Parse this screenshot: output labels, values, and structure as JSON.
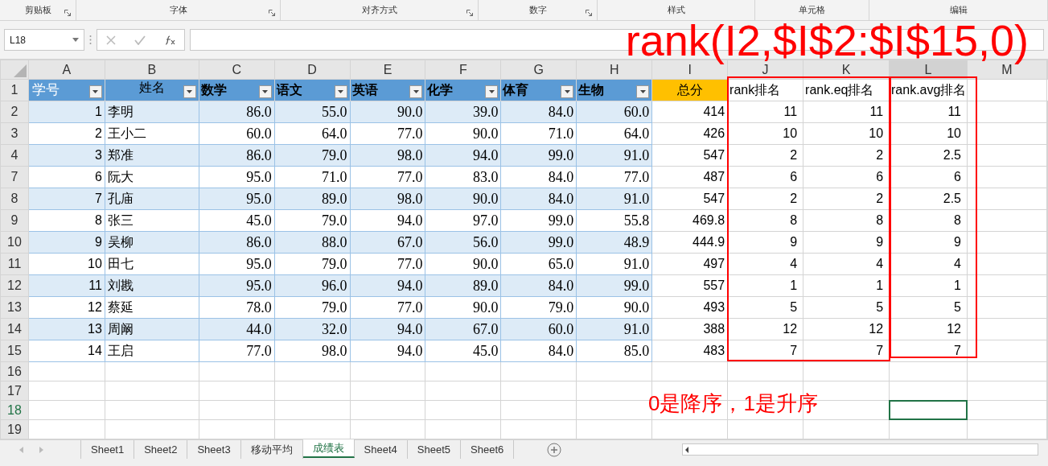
{
  "ribbon_groups": [
    {
      "label": "剪贴板",
      "launcher": true
    },
    {
      "label": "字体",
      "launcher": true
    },
    {
      "label": "对齐方式",
      "launcher": true
    },
    {
      "label": "数字",
      "launcher": true
    },
    {
      "label": "样式",
      "launcher": false
    },
    {
      "label": "单元格",
      "launcher": false
    },
    {
      "label": "编辑",
      "launcher": false
    }
  ],
  "name_box": "L18",
  "columns": [
    {
      "label": "A",
      "selected": false
    },
    {
      "label": "B",
      "selected": false
    },
    {
      "label": "C",
      "selected": false
    },
    {
      "label": "D",
      "selected": false
    },
    {
      "label": "E",
      "selected": false
    },
    {
      "label": "F",
      "selected": false
    },
    {
      "label": "G",
      "selected": false
    },
    {
      "label": "H",
      "selected": false
    },
    {
      "label": "I",
      "selected": false
    },
    {
      "label": "J",
      "selected": false
    },
    {
      "label": "K",
      "selected": false
    },
    {
      "label": "L",
      "selected": true
    },
    {
      "label": "M",
      "selected": false
    }
  ],
  "header_row": {
    "row": "1",
    "cells": [
      {
        "text": "学号",
        "kind": "filter_id"
      },
      {
        "text": "姓名",
        "kind": "filter_name"
      },
      {
        "text": "数学",
        "kind": "filter"
      },
      {
        "text": "语文",
        "kind": "filter"
      },
      {
        "text": "英语",
        "kind": "filter"
      },
      {
        "text": "化学",
        "kind": "filter"
      },
      {
        "text": "体育",
        "kind": "filter"
      },
      {
        "text": "生物",
        "kind": "filter"
      },
      {
        "text": "总分",
        "kind": "total"
      },
      {
        "text": "rank排名",
        "kind": "plain"
      },
      {
        "text": "rank.eq排名",
        "kind": "plain"
      },
      {
        "text": "rank.avg排名",
        "kind": "plain"
      }
    ]
  },
  "data_rows": [
    {
      "row": "2",
      "banded": true,
      "cells": [
        "1",
        "李明",
        "86.0",
        "55.0",
        "90.0",
        "39.0",
        "84.0",
        "60.0",
        "414",
        "11",
        "11",
        "11"
      ]
    },
    {
      "row": "3",
      "banded": false,
      "cells": [
        "2",
        "王小二",
        "60.0",
        "64.0",
        "77.0",
        "90.0",
        "71.0",
        "64.0",
        "426",
        "10",
        "10",
        "10"
      ]
    },
    {
      "row": "4",
      "banded": true,
      "cells": [
        "3",
        "郑准",
        "86.0",
        "79.0",
        "98.0",
        "94.0",
        "99.0",
        "91.0",
        "547",
        "2",
        "2",
        "2.5"
      ]
    },
    {
      "row": "7",
      "banded": false,
      "cells": [
        "6",
        "阮大",
        "95.0",
        "71.0",
        "77.0",
        "83.0",
        "84.0",
        "77.0",
        "487",
        "6",
        "6",
        "6"
      ]
    },
    {
      "row": "8",
      "banded": true,
      "cells": [
        "7",
        "孔庙",
        "95.0",
        "89.0",
        "98.0",
        "90.0",
        "84.0",
        "91.0",
        "547",
        "2",
        "2",
        "2.5"
      ]
    },
    {
      "row": "9",
      "banded": false,
      "cells": [
        "8",
        "张三",
        "45.0",
        "79.0",
        "94.0",
        "97.0",
        "99.0",
        "55.8",
        "469.8",
        "8",
        "8",
        "8"
      ]
    },
    {
      "row": "10",
      "banded": true,
      "cells": [
        "9",
        "吴柳",
        "86.0",
        "88.0",
        "67.0",
        "56.0",
        "99.0",
        "48.9",
        "444.9",
        "9",
        "9",
        "9"
      ]
    },
    {
      "row": "11",
      "banded": false,
      "cells": [
        "10",
        "田七",
        "95.0",
        "79.0",
        "77.0",
        "90.0",
        "65.0",
        "91.0",
        "497",
        "4",
        "4",
        "4"
      ]
    },
    {
      "row": "12",
      "banded": true,
      "cells": [
        "11",
        "刘戡",
        "95.0",
        "96.0",
        "94.0",
        "89.0",
        "84.0",
        "99.0",
        "557",
        "1",
        "1",
        "1"
      ]
    },
    {
      "row": "13",
      "banded": false,
      "cells": [
        "12",
        "蔡延",
        "78.0",
        "79.0",
        "77.0",
        "90.0",
        "79.0",
        "90.0",
        "493",
        "5",
        "5",
        "5"
      ]
    },
    {
      "row": "14",
      "banded": true,
      "cells": [
        "13",
        "周阚",
        "44.0",
        "32.0",
        "94.0",
        "67.0",
        "60.0",
        "91.0",
        "388",
        "12",
        "12",
        "12"
      ]
    },
    {
      "row": "15",
      "banded": false,
      "cells": [
        "14",
        "王启",
        "77.0",
        "98.0",
        "94.0",
        "45.0",
        "84.0",
        "85.0",
        "483",
        "7",
        "7",
        "7"
      ]
    }
  ],
  "empty_rows": [
    {
      "row": "16",
      "selected": false
    },
    {
      "row": "17",
      "selected": false
    },
    {
      "row": "18",
      "selected": true
    },
    {
      "row": "19",
      "selected": false
    }
  ],
  "annotations": {
    "formula_note": "rank(I2,$I$2:$I$15,0)",
    "order_note": "0是降序，1是升序"
  },
  "sheet_tabs": [
    {
      "label": "Sheet1",
      "selected": false
    },
    {
      "label": "Sheet2",
      "selected": false
    },
    {
      "label": "Sheet3",
      "selected": false
    },
    {
      "label": "移动平均",
      "selected": false
    },
    {
      "label": "成绩表",
      "selected": true
    },
    {
      "label": "Sheet4",
      "selected": false
    },
    {
      "label": "Sheet5",
      "selected": false
    },
    {
      "label": "Sheet6",
      "selected": false
    }
  ]
}
